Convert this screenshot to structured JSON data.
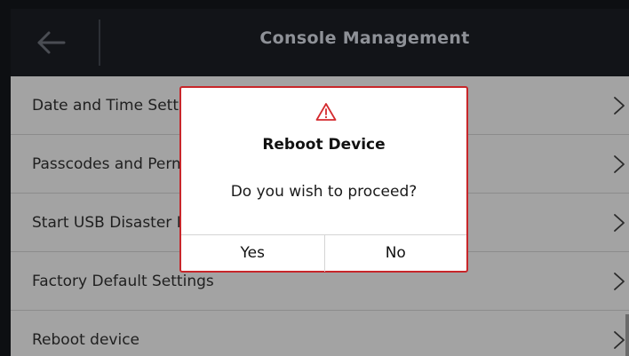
{
  "header": {
    "title": "Console Management",
    "back_icon": "arrow-left-icon"
  },
  "list": {
    "items": [
      {
        "label": "Date and Time Settings",
        "icon": "chevron-right-icon"
      },
      {
        "label": "Passcodes and Permissions",
        "icon": "chevron-right-icon"
      },
      {
        "label": "Start USB Disaster Recovery",
        "icon": "chevron-right-icon"
      },
      {
        "label": "Factory Default Settings",
        "icon": "chevron-right-icon"
      },
      {
        "label": "Reboot device",
        "icon": "chevron-right-icon"
      }
    ]
  },
  "dialog": {
    "icon": "warning-icon",
    "title": "Reboot Device",
    "message": "Do you wish to proceed?",
    "yes_label": "Yes",
    "no_label": "No"
  },
  "colors": {
    "header_bg": "#121418",
    "list_bg": "#a3a3a3",
    "dialog_border": "#c7262a",
    "warning_icon": "#d42a2e"
  }
}
